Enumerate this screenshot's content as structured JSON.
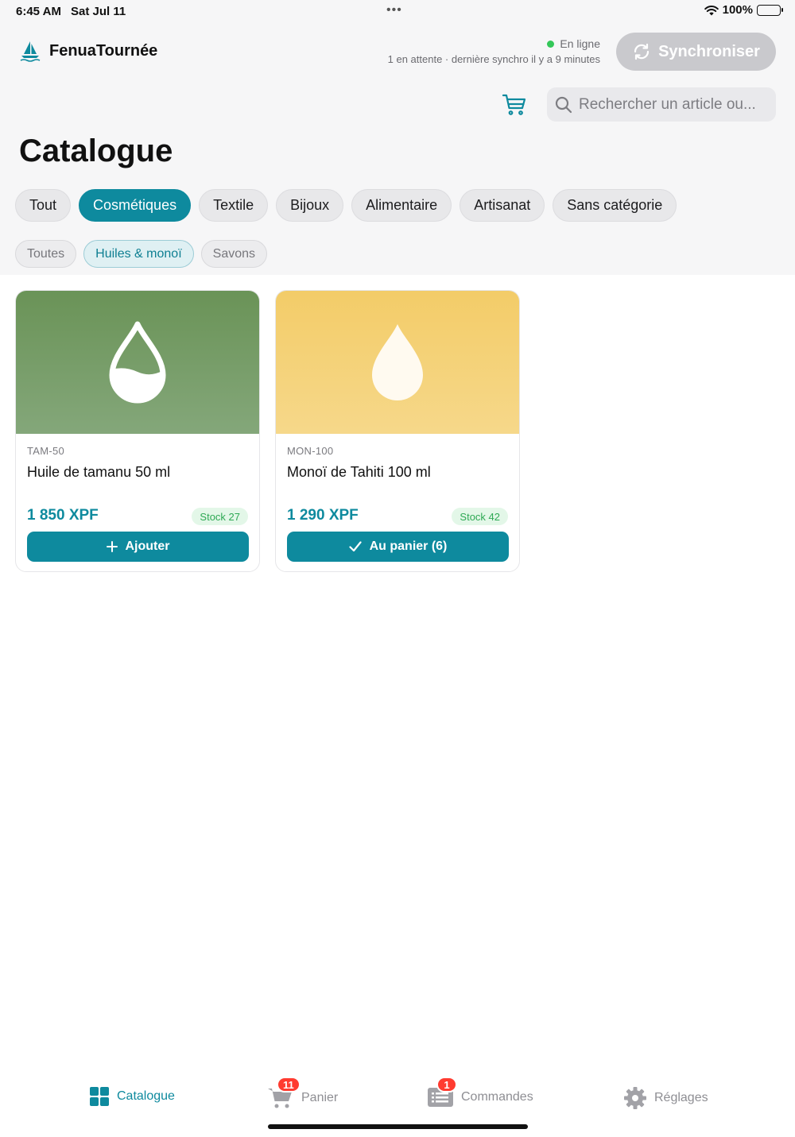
{
  "status": {
    "time": "6:45 AM",
    "date": "Sat Jul 11",
    "battery": "100%"
  },
  "app": {
    "name": "FenuaTournée"
  },
  "connection": {
    "status": "En ligne",
    "detail": "1 en attente · dernière synchro il y a 9 minutes"
  },
  "sync": {
    "label": "Synchroniser"
  },
  "search": {
    "placeholder": "Rechercher un article ou..."
  },
  "page": {
    "title": "Catalogue"
  },
  "categories": [
    {
      "label": "Tout",
      "active": false
    },
    {
      "label": "Cosmétiques",
      "active": true
    },
    {
      "label": "Textile",
      "active": false
    },
    {
      "label": "Bijoux",
      "active": false
    },
    {
      "label": "Alimentaire",
      "active": false
    },
    {
      "label": "Artisanat",
      "active": false
    },
    {
      "label": "Sans catégorie",
      "active": false
    }
  ],
  "subcategories": [
    {
      "label": "Toutes",
      "active": false
    },
    {
      "label": "Huiles & monoï",
      "active": true
    },
    {
      "label": "Savons",
      "active": false
    }
  ],
  "products": [
    {
      "sku": "TAM-50",
      "name": "Huile de tamanu 50 ml",
      "price": "1 850 XPF",
      "stock": "Stock 27",
      "action": "Ajouter",
      "action_icon": "plus-icon",
      "image_icon": "drop-half-icon"
    },
    {
      "sku": "MON-100",
      "name": "Monoï de Tahiti 100 ml",
      "price": "1 290 XPF",
      "stock": "Stock 42",
      "action": "Au panier (6)",
      "action_icon": "checkmark-icon",
      "image_icon": "drop-icon"
    }
  ],
  "tabs": [
    {
      "label": "Catalogue",
      "icon": "grid-icon",
      "active": true
    },
    {
      "label": "Panier",
      "icon": "cart-icon",
      "badge": "11"
    },
    {
      "label": "Commandes",
      "icon": "list-icon",
      "badge": "1"
    },
    {
      "label": "Réglages",
      "icon": "gear-icon"
    }
  ],
  "colors": {
    "accent": "#0e8a9e",
    "online": "#34c759",
    "badge": "#ff3b30",
    "stock_text": "#2fa955"
  }
}
